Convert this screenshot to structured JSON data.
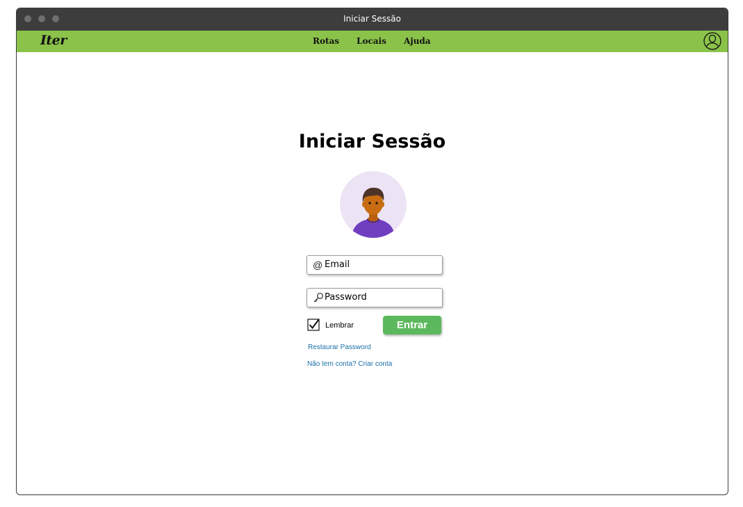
{
  "window": {
    "title": "Iniciar Sessão"
  },
  "navbar": {
    "logo": "Iter",
    "links": [
      "Rotas",
      "Locais",
      "Ajuda"
    ],
    "accent_color": "#8bc34a",
    "account_icon": "user-circle-icon"
  },
  "login": {
    "heading": "Iniciar Sessão",
    "avatar_icon": "user-avatar-icon",
    "email": {
      "placeholder": "Email",
      "icon": "at-sign-icon",
      "value": ""
    },
    "password": {
      "placeholder": "Password",
      "icon": "key-icon",
      "value": ""
    },
    "remember": {
      "label": "Lembrar",
      "checked": true
    },
    "submit_label": "Entrar",
    "submit_color": "#5cb85c",
    "restore_link": "Restaurar Password",
    "signup_link": "Não tem conta? Criar conta"
  }
}
